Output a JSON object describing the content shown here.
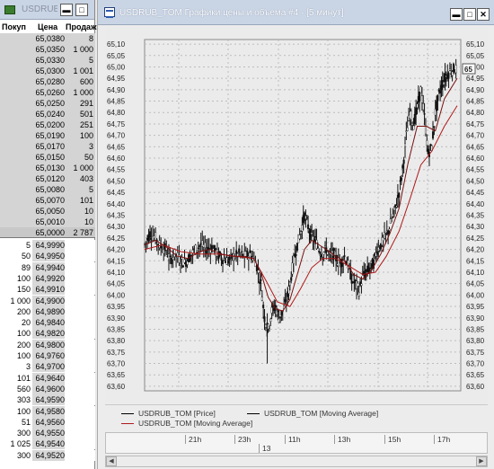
{
  "book": {
    "title": "USDRUB_TOM",
    "headers": {
      "buy": "Покуп",
      "price": "Цена",
      "sell": "Продаж"
    },
    "asks": [
      {
        "price": "65,0380",
        "qty": "8"
      },
      {
        "price": "65,0350",
        "qty": "1 000"
      },
      {
        "price": "65,0330",
        "qty": "5"
      },
      {
        "price": "65,0300",
        "qty": "1 001"
      },
      {
        "price": "65,0280",
        "qty": "600"
      },
      {
        "price": "65,0260",
        "qty": "1 000"
      },
      {
        "price": "65,0250",
        "qty": "291"
      },
      {
        "price": "65,0240",
        "qty": "501"
      },
      {
        "price": "65,0200",
        "qty": "251"
      },
      {
        "price": "65,0190",
        "qty": "100"
      },
      {
        "price": "65,0170",
        "qty": "3"
      },
      {
        "price": "65,0150",
        "qty": "50"
      },
      {
        "price": "65,0130",
        "qty": "1 000"
      },
      {
        "price": "65,0120",
        "qty": "403"
      },
      {
        "price": "65,0080",
        "qty": "5"
      },
      {
        "price": "65,0070",
        "qty": "101"
      },
      {
        "price": "65,0050",
        "qty": "10"
      },
      {
        "price": "65,0010",
        "qty": "10"
      },
      {
        "price": "65,0000",
        "qty": "2 787"
      }
    ],
    "bids": [
      {
        "qty": "5",
        "price": "64,9990"
      },
      {
        "qty": "50",
        "price": "64,9950"
      },
      {
        "qty": "89",
        "price": "64,9940"
      },
      {
        "qty": "100",
        "price": "64,9920"
      },
      {
        "qty": "150",
        "price": "64,9910"
      },
      {
        "qty": "1 000",
        "price": "64,9900"
      },
      {
        "qty": "200",
        "price": "64,9890"
      },
      {
        "qty": "20",
        "price": "64,9840"
      },
      {
        "qty": "100",
        "price": "64,9820"
      },
      {
        "qty": "200",
        "price": "64,9800"
      },
      {
        "qty": "100",
        "price": "64,9760"
      },
      {
        "qty": "3",
        "price": "64,9700"
      },
      {
        "qty": "101",
        "price": "64,9640"
      },
      {
        "qty": "560",
        "price": "64,9600"
      },
      {
        "qty": "303",
        "price": "64,9590"
      },
      {
        "qty": "100",
        "price": "64,9580"
      },
      {
        "qty": "51",
        "price": "64,9560"
      },
      {
        "qty": "300",
        "price": "64,9550"
      },
      {
        "qty": "1 025",
        "price": "64,9540"
      },
      {
        "qty": "300",
        "price": "64,9520"
      }
    ]
  },
  "chart_window": {
    "title": "USDRUB_TOM Графики цены и объема #4 - [5 минут]",
    "last_price_label": "65",
    "legend": [
      {
        "label": "USDRUB_TOM [Price]",
        "color": "#000000"
      },
      {
        "label": "USDRUB_TOM [Moving Average]",
        "color": "#000000"
      },
      {
        "label": "USDRUB_TOM [Moving Average]",
        "color": "#b01818"
      }
    ],
    "time_ticks": [
      "21h",
      "23h",
      "11h",
      "13h",
      "15h",
      "17h"
    ],
    "date_label": "13"
  },
  "chart_data": {
    "type": "candlestick",
    "y_ticks": [
      "65,10",
      "65,05",
      "65,00",
      "64,95",
      "64,90",
      "64,85",
      "64,80",
      "64,75",
      "64,70",
      "64,65",
      "64,60",
      "64,55",
      "64,50",
      "64,45",
      "64,40",
      "64,35",
      "64,30",
      "64,25",
      "64,20",
      "64,15",
      "64,10",
      "64,05",
      "64,00",
      "63,95",
      "63,90",
      "63,85",
      "63,80",
      "63,75",
      "63,70",
      "63,65",
      "63,60"
    ],
    "ylim": [
      63.58,
      65.12
    ],
    "price_path": [
      [
        0,
        64.22
      ],
      [
        6,
        64.27
      ],
      [
        12,
        64.25
      ],
      [
        18,
        64.21
      ],
      [
        24,
        64.2
      ],
      [
        28,
        64.15
      ],
      [
        33,
        64.18
      ],
      [
        38,
        64.16
      ],
      [
        44,
        64.14
      ],
      [
        50,
        64.17
      ],
      [
        56,
        64.2
      ],
      [
        62,
        64.22
      ],
      [
        68,
        64.2
      ],
      [
        74,
        64.21
      ],
      [
        80,
        64.18
      ],
      [
        86,
        64.16
      ],
      [
        92,
        64.15
      ],
      [
        98,
        64.17
      ],
      [
        104,
        64.18
      ],
      [
        110,
        64.17
      ],
      [
        116,
        64.18
      ],
      [
        122,
        64.15
      ],
      [
        128,
        64.05
      ],
      [
        132,
        63.9
      ],
      [
        136,
        63.85
      ],
      [
        140,
        63.93
      ],
      [
        144,
        63.95
      ],
      [
        148,
        63.9
      ],
      [
        152,
        63.93
      ],
      [
        156,
        63.97
      ],
      [
        160,
        64.05
      ],
      [
        164,
        64.15
      ],
      [
        168,
        64.22
      ],
      [
        172,
        64.28
      ],
      [
        176,
        64.35
      ],
      [
        180,
        64.3
      ],
      [
        184,
        64.25
      ],
      [
        188,
        64.24
      ],
      [
        192,
        64.2
      ],
      [
        196,
        64.18
      ],
      [
        200,
        64.2
      ],
      [
        204,
        64.17
      ],
      [
        208,
        64.18
      ],
      [
        212,
        64.15
      ],
      [
        216,
        64.14
      ],
      [
        220,
        64.17
      ],
      [
        224,
        64.13
      ],
      [
        228,
        64.07
      ],
      [
        232,
        64.05
      ],
      [
        236,
        64.02
      ],
      [
        240,
        64.08
      ],
      [
        244,
        64.1
      ],
      [
        248,
        64.12
      ],
      [
        252,
        64.14
      ],
      [
        256,
        64.2
      ],
      [
        260,
        64.22
      ],
      [
        264,
        64.25
      ],
      [
        268,
        64.28
      ],
      [
        272,
        64.33
      ],
      [
        276,
        64.38
      ],
      [
        280,
        64.45
      ],
      [
        284,
        64.55
      ],
      [
        288,
        64.7
      ],
      [
        292,
        64.8
      ],
      [
        296,
        64.75
      ],
      [
        300,
        64.82
      ],
      [
        304,
        64.9
      ],
      [
        308,
        64.78
      ],
      [
        312,
        64.62
      ],
      [
        316,
        64.65
      ],
      [
        320,
        64.8
      ],
      [
        324,
        64.88
      ],
      [
        328,
        64.93
      ],
      [
        332,
        64.96
      ],
      [
        336,
        64.98
      ],
      [
        340,
        64.99
      ],
      [
        344,
        64.99
      ]
    ],
    "ma_fast": [
      [
        0,
        64.22
      ],
      [
        12,
        64.24
      ],
      [
        24,
        64.21
      ],
      [
        36,
        64.17
      ],
      [
        48,
        64.16
      ],
      [
        60,
        64.19
      ],
      [
        72,
        64.2
      ],
      [
        84,
        64.18
      ],
      [
        96,
        64.17
      ],
      [
        108,
        64.17
      ],
      [
        120,
        64.16
      ],
      [
        128,
        64.1
      ],
      [
        136,
        63.99
      ],
      [
        144,
        63.94
      ],
      [
        152,
        63.93
      ],
      [
        160,
        63.98
      ],
      [
        168,
        64.09
      ],
      [
        176,
        64.2
      ],
      [
        184,
        64.24
      ],
      [
        192,
        64.22
      ],
      [
        200,
        64.2
      ],
      [
        210,
        64.17
      ],
      [
        220,
        64.15
      ],
      [
        230,
        64.09
      ],
      [
        240,
        64.07
      ],
      [
        250,
        64.11
      ],
      [
        260,
        64.18
      ],
      [
        270,
        64.27
      ],
      [
        280,
        64.38
      ],
      [
        290,
        64.58
      ],
      [
        300,
        64.74
      ],
      [
        310,
        64.74
      ],
      [
        320,
        64.72
      ],
      [
        330,
        64.86
      ],
      [
        344,
        64.95
      ]
    ],
    "ma_slow": [
      [
        0,
        64.2
      ],
      [
        20,
        64.22
      ],
      [
        40,
        64.19
      ],
      [
        60,
        64.18
      ],
      [
        80,
        64.18
      ],
      [
        100,
        64.17
      ],
      [
        120,
        64.16
      ],
      [
        134,
        64.06
      ],
      [
        146,
        63.97
      ],
      [
        160,
        63.95
      ],
      [
        172,
        64.03
      ],
      [
        184,
        64.12
      ],
      [
        196,
        64.16
      ],
      [
        210,
        64.16
      ],
      [
        224,
        64.13
      ],
      [
        240,
        64.09
      ],
      [
        254,
        64.1
      ],
      [
        266,
        64.17
      ],
      [
        280,
        64.28
      ],
      [
        292,
        64.42
      ],
      [
        304,
        64.57
      ],
      [
        316,
        64.63
      ],
      [
        330,
        64.74
      ],
      [
        344,
        64.83
      ]
    ]
  }
}
